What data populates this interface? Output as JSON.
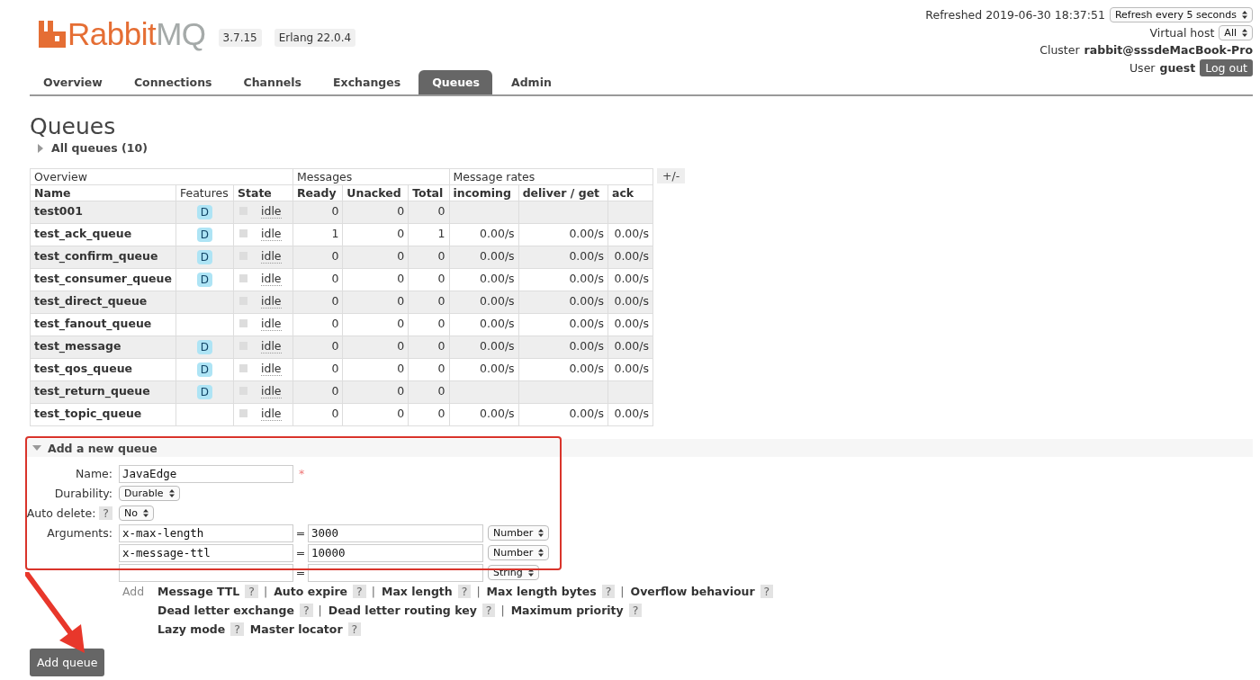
{
  "logo": {
    "part_1": "Rabbit",
    "part_2": "MQ"
  },
  "versions": [
    "3.7.15",
    "Erlang 22.0.4"
  ],
  "status": {
    "refreshed": "Refreshed 2019-06-30 18:37:51",
    "refresh_select": "Refresh every 5 seconds",
    "vhost_label": "Virtual host",
    "vhost_select": "All",
    "cluster_label": "Cluster",
    "cluster": "rabbit@sssdeMacBook-Pro",
    "user_label": "User",
    "user": "guest",
    "logout": "Log out"
  },
  "tabs": [
    {
      "label": "Overview",
      "selected": false
    },
    {
      "label": "Connections",
      "selected": false
    },
    {
      "label": "Channels",
      "selected": false
    },
    {
      "label": "Exchanges",
      "selected": false
    },
    {
      "label": "Queues",
      "selected": true
    },
    {
      "label": "Admin",
      "selected": false
    }
  ],
  "page_title": "Queues",
  "all_queues": {
    "label": "All queues (10)",
    "expanded": false
  },
  "table": {
    "groups": [
      {
        "label": "Overview"
      },
      {
        "label": "Messages"
      },
      {
        "label": "Message rates"
      }
    ],
    "toggle": "+/-",
    "columns": [
      {
        "label": "Name",
        "bold": true
      },
      {
        "label": "Features",
        "bold": false
      },
      {
        "label": "State",
        "bold": true
      },
      {
        "label": "Ready",
        "bold": true
      },
      {
        "label": "Unacked",
        "bold": true
      },
      {
        "label": "Total",
        "bold": true
      },
      {
        "label": "incoming",
        "bold": true
      },
      {
        "label": "deliver / get",
        "bold": true
      },
      {
        "label": "ack",
        "bold": true
      }
    ],
    "rows": [
      {
        "name": "test001",
        "feature": "D",
        "state": "idle",
        "ready": "0",
        "unacked": "0",
        "total": "0"
      },
      {
        "name": "test_ack_queue",
        "feature": "D",
        "state": "idle",
        "ready": "1",
        "unacked": "0",
        "total": "1",
        "incoming": "0.00/s",
        "deliver": "0.00/s",
        "ack": "0.00/s"
      },
      {
        "name": "test_confirm_queue",
        "feature": "D",
        "state": "idle",
        "ready": "0",
        "unacked": "0",
        "total": "0",
        "incoming": "0.00/s",
        "deliver": "0.00/s",
        "ack": "0.00/s"
      },
      {
        "name": "test_consumer_queue",
        "feature": "D",
        "state": "idle",
        "ready": "0",
        "unacked": "0",
        "total": "0",
        "incoming": "0.00/s",
        "deliver": "0.00/s",
        "ack": "0.00/s"
      },
      {
        "name": "test_direct_queue",
        "state": "idle",
        "ready": "0",
        "unacked": "0",
        "total": "0",
        "incoming": "0.00/s",
        "deliver": "0.00/s",
        "ack": "0.00/s"
      },
      {
        "name": "test_fanout_queue",
        "state": "idle",
        "ready": "0",
        "unacked": "0",
        "total": "0",
        "incoming": "0.00/s",
        "deliver": "0.00/s",
        "ack": "0.00/s"
      },
      {
        "name": "test_message",
        "feature": "D",
        "state": "idle",
        "ready": "0",
        "unacked": "0",
        "total": "0",
        "incoming": "0.00/s",
        "deliver": "0.00/s",
        "ack": "0.00/s"
      },
      {
        "name": "test_qos_queue",
        "feature": "D",
        "state": "idle",
        "ready": "0",
        "unacked": "0",
        "total": "0",
        "incoming": "0.00/s",
        "deliver": "0.00/s",
        "ack": "0.00/s"
      },
      {
        "name": "test_return_queue",
        "feature": "D",
        "state": "idle",
        "ready": "0",
        "unacked": "0",
        "total": "0"
      },
      {
        "name": "test_topic_queue",
        "state": "idle",
        "ready": "0",
        "unacked": "0",
        "total": "0",
        "incoming": "0.00/s",
        "deliver": "0.00/s",
        "ack": "0.00/s"
      }
    ]
  },
  "add_queue": {
    "title": "Add a new queue",
    "expanded": true,
    "name_label": "Name:",
    "name_value": "JavaEdge",
    "required_mark": "*",
    "durability_label": "Durability:",
    "durability": "Durable",
    "auto_delete_label": "Auto delete:",
    "help": "?",
    "auto_delete": "No",
    "arguments_label": "Arguments:",
    "equals": "=",
    "arguments": [
      {
        "key": "x-max-length",
        "value": "3000",
        "type": "Number"
      },
      {
        "key": "x-message-ttl",
        "value": "10000",
        "type": "Number"
      },
      {
        "type": "String"
      }
    ],
    "add_label": "Add",
    "shortcut_lines": [
      [
        {
          "label": "Message TTL",
          "help": "?",
          "separator": "|"
        },
        {
          "label": "Auto expire",
          "help": "?",
          "separator": "|"
        },
        {
          "label": "Max length",
          "help": "?",
          "separator": "|"
        },
        {
          "label": "Max length bytes",
          "help": "?",
          "separator": "|"
        },
        {
          "label": "Overflow behaviour",
          "help": "?"
        }
      ],
      [
        {
          "label": "Dead letter exchange",
          "help": "?",
          "separator": "|"
        },
        {
          "label": "Dead letter routing key",
          "help": "?",
          "separator": "|"
        },
        {
          "label": "Maximum priority",
          "help": "?"
        }
      ],
      [
        {
          "label": "Lazy mode",
          "help": "?"
        },
        {
          "label": "Master locator",
          "help": "?"
        }
      ]
    ],
    "submit": "Add queue"
  },
  "annotations": {
    "highlight_box": true,
    "arrow": true
  }
}
